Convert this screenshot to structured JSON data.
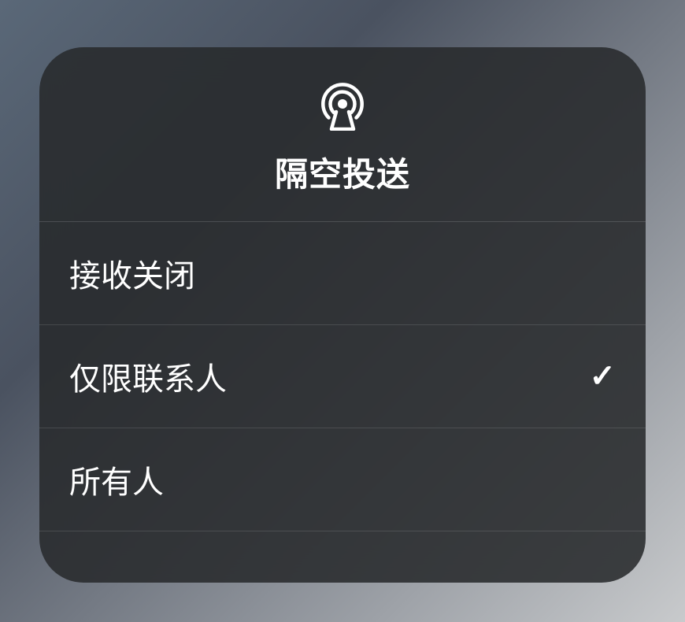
{
  "panel": {
    "title": "隔空投送",
    "options": [
      {
        "label": "接收关闭",
        "selected": false
      },
      {
        "label": "仅限联系人",
        "selected": true
      },
      {
        "label": "所有人",
        "selected": false
      }
    ]
  }
}
